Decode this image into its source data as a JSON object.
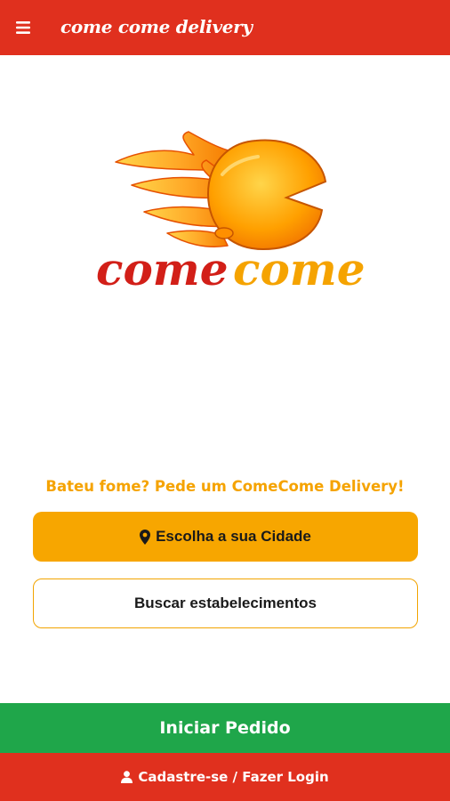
{
  "header": {
    "app_title": "come come delivery",
    "menu_icon": "hamburger-menu-icon",
    "background": "#e0301e"
  },
  "logo": {
    "word1": "come",
    "word2": "come",
    "word1_color": "#d21f18",
    "word2_color": "#f5a300"
  },
  "main": {
    "tagline": "Bateu fome? Pede um ComeCome Delivery!",
    "choose_city": {
      "icon": "map-marker-icon",
      "label": "Escolha a sua Cidade"
    },
    "search_button": "Buscar estabelecimentos"
  },
  "footer": {
    "start_order": "Iniciar Pedido",
    "login": {
      "icon": "user-icon",
      "label": "Cadastre-se / Fazer Login"
    }
  },
  "colors": {
    "accent": "#f7a600",
    "primary_red": "#e0301e",
    "green": "#1fa64a"
  }
}
